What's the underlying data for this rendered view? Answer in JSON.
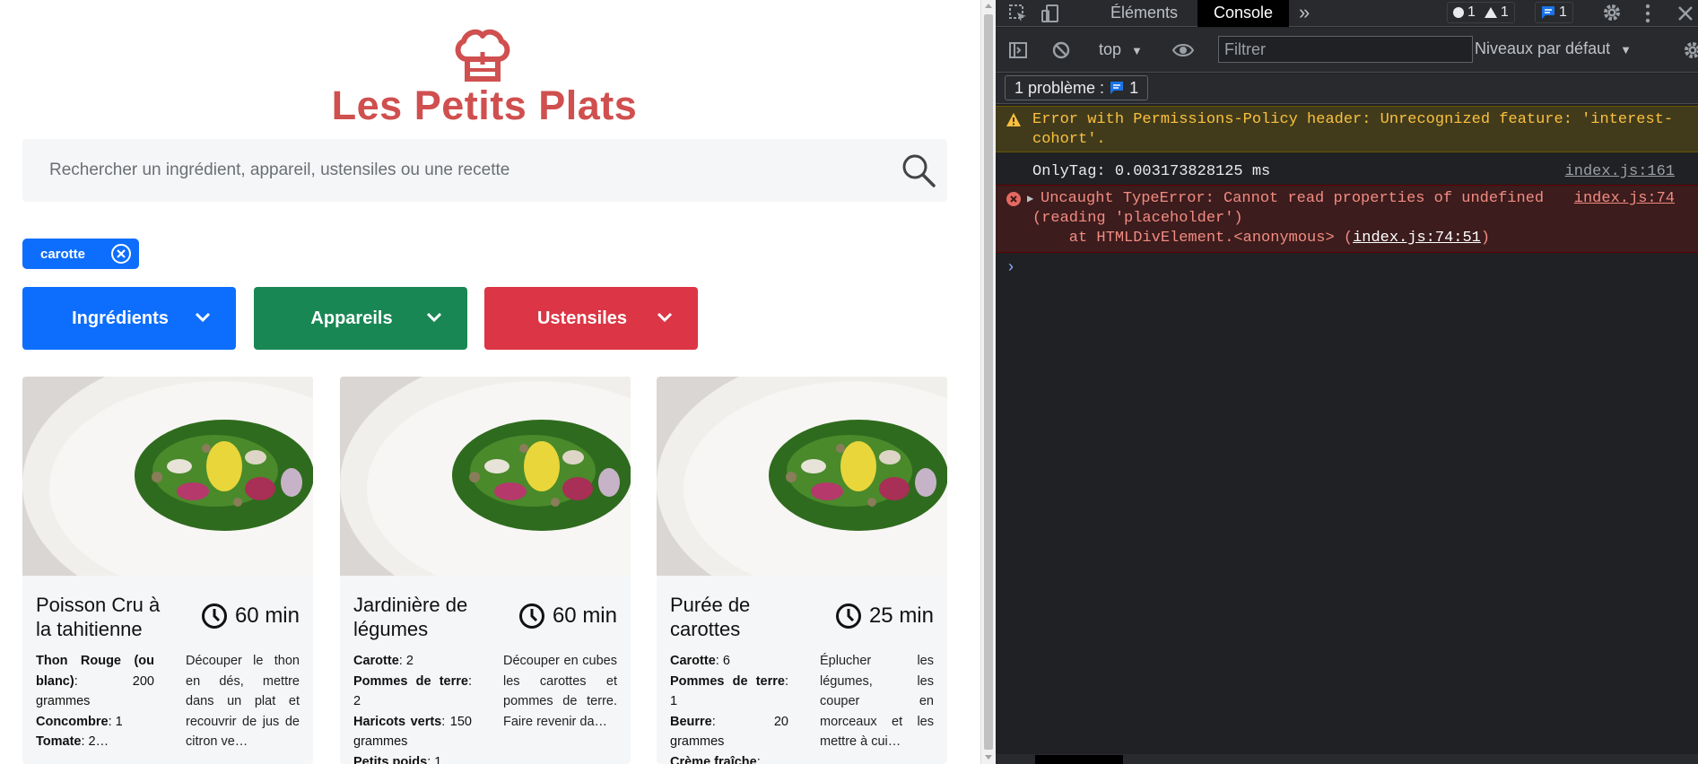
{
  "site": {
    "title": "Les Petits Plats",
    "search_placeholder": "Rechercher un ingrédient, appareil, ustensiles ou une recette"
  },
  "tags": [
    {
      "label": "carotte",
      "color": "#0d6efd"
    }
  ],
  "filters": [
    {
      "label": "Ingrédients",
      "color": "#0d6efd"
    },
    {
      "label": "Appareils",
      "color": "#198754"
    },
    {
      "label": "Ustensiles",
      "color": "#dc3545"
    }
  ],
  "recipes": [
    {
      "title": "Poisson Cru à la tahitienne",
      "time": "60 min",
      "ingredients": [
        {
          "name": "Thon Rouge (ou blanc)",
          "qty": ": 200 grammes"
        },
        {
          "name": "Concombre",
          "qty": ": 1"
        },
        {
          "name": "Tomate",
          "qty": ": 2…"
        }
      ],
      "description": "Découper le thon en dés, mettre dans un plat et recouvrir de jus de citron ve…"
    },
    {
      "title": "Jardinière de légumes",
      "time": "60 min",
      "ingredients": [
        {
          "name": "Carotte",
          "qty": ": 2"
        },
        {
          "name": "Pommes de terre",
          "qty": ": 2"
        },
        {
          "name": "Haricots verts",
          "qty": ": 150 grammes"
        },
        {
          "name": "Petits poids",
          "qty": ": 1…"
        }
      ],
      "description": "Découper en cubes les carottes et pommes de terre. Faire revenir da…"
    },
    {
      "title": "Purée de carottes",
      "time": "25 min",
      "ingredients": [
        {
          "name": "Carotte",
          "qty": ": 6"
        },
        {
          "name": "Pommes de terre",
          "qty": ": 1"
        },
        {
          "name": "Beurre",
          "qty": ": 20 grammes"
        },
        {
          "name": "Crème fraîche",
          "qty": ":…"
        }
      ],
      "description": "Éplucher les légumes, les couper en morceaux et les mettre à cui…"
    }
  ],
  "devtools": {
    "tabs": {
      "elements": "Éléments",
      "console": "Console",
      "more": "»"
    },
    "counts": {
      "errors": "1",
      "warnings": "1",
      "messages": "1"
    },
    "toolbar": {
      "context": "top",
      "filter_placeholder": "Filtrer",
      "levels": "Niveaux par défaut"
    },
    "issues": {
      "label": "1 problème :",
      "count": "1"
    },
    "messages": {
      "warning": "Error with Permissions-Policy header: Unrecognized feature: 'interest-\ncohort'.",
      "log": "OnlyTag: 0.003173828125 ms",
      "log_source": "index.js:161",
      "error_line1": "Uncaught TypeError: Cannot read properties of undefined",
      "error_line2": "(reading 'placeholder')",
      "error_line3_prefix": "    at HTMLDivElement.<anonymous> (",
      "error_line3_link": "index.js:74:51",
      "error_line3_suffix": ")",
      "error_source": "index.js:74"
    },
    "prompt": "›"
  },
  "colors": {
    "brand": "#d04f4f",
    "devtools_bg": "#202124",
    "warning_text": "#fbc03d",
    "error_text": "#f28b82"
  }
}
